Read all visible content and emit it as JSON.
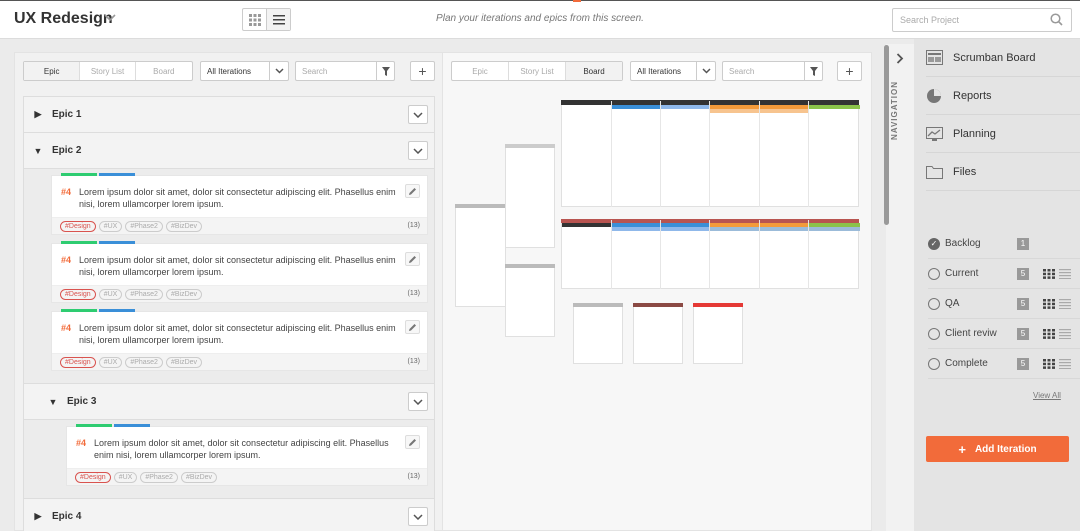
{
  "project": {
    "title": "UX Redesign",
    "tagline": "Plan your iterations and epics from this screen.",
    "search_placeholder": "Search Project"
  },
  "left_toolbar": {
    "tabs": [
      "Epic",
      "Story List",
      "Board"
    ],
    "active_tab": "Epic",
    "iteration_select": "All Iterations",
    "search_placeholder": "Search"
  },
  "right_toolbar": {
    "tabs": [
      "Epic",
      "Story List",
      "Board"
    ],
    "active_tab": "Board",
    "iteration_select": "All Iterations",
    "search_placeholder": "Search"
  },
  "epics": [
    {
      "label": "Epic 1",
      "expanded": false
    },
    {
      "label": "Epic 2",
      "expanded": true
    },
    {
      "label": "Epic 3",
      "expanded": true
    },
    {
      "label": "Epic 4",
      "expanded": false
    }
  ],
  "story": {
    "number": "#4",
    "text": "Lorem ipsum dolor sit amet, dolor sit consectetur adipiscing elit. Phasellus enim nisi, lorem ullamcorper lorem ipsum.",
    "tags": [
      "#Design",
      "#UX",
      "#Phase2",
      "#BizDev"
    ],
    "count": "(13)"
  },
  "colors": {
    "accent": "#f26b3a",
    "green": "#2ecc71",
    "blue": "#3a8fd8"
  },
  "navigation": {
    "label": "NAVIGATION",
    "items": [
      {
        "label": "Scrumban Board",
        "icon": "board-icon"
      },
      {
        "label": "Reports",
        "icon": "pie-chart-icon"
      },
      {
        "label": "Planning",
        "icon": "planning-chart-icon"
      },
      {
        "label": "Files",
        "icon": "folder-icon"
      }
    ]
  },
  "iterations": [
    {
      "label": "Backlog",
      "count": "1",
      "checked": true
    },
    {
      "label": "Current",
      "count": "5",
      "checked": false
    },
    {
      "label": "QA",
      "count": "5",
      "checked": false
    },
    {
      "label": "Client reviw",
      "count": "5",
      "checked": false
    },
    {
      "label": "Complete",
      "count": "5",
      "checked": false
    }
  ],
  "view_all": "View All",
  "add_iteration": "Add Iteration"
}
